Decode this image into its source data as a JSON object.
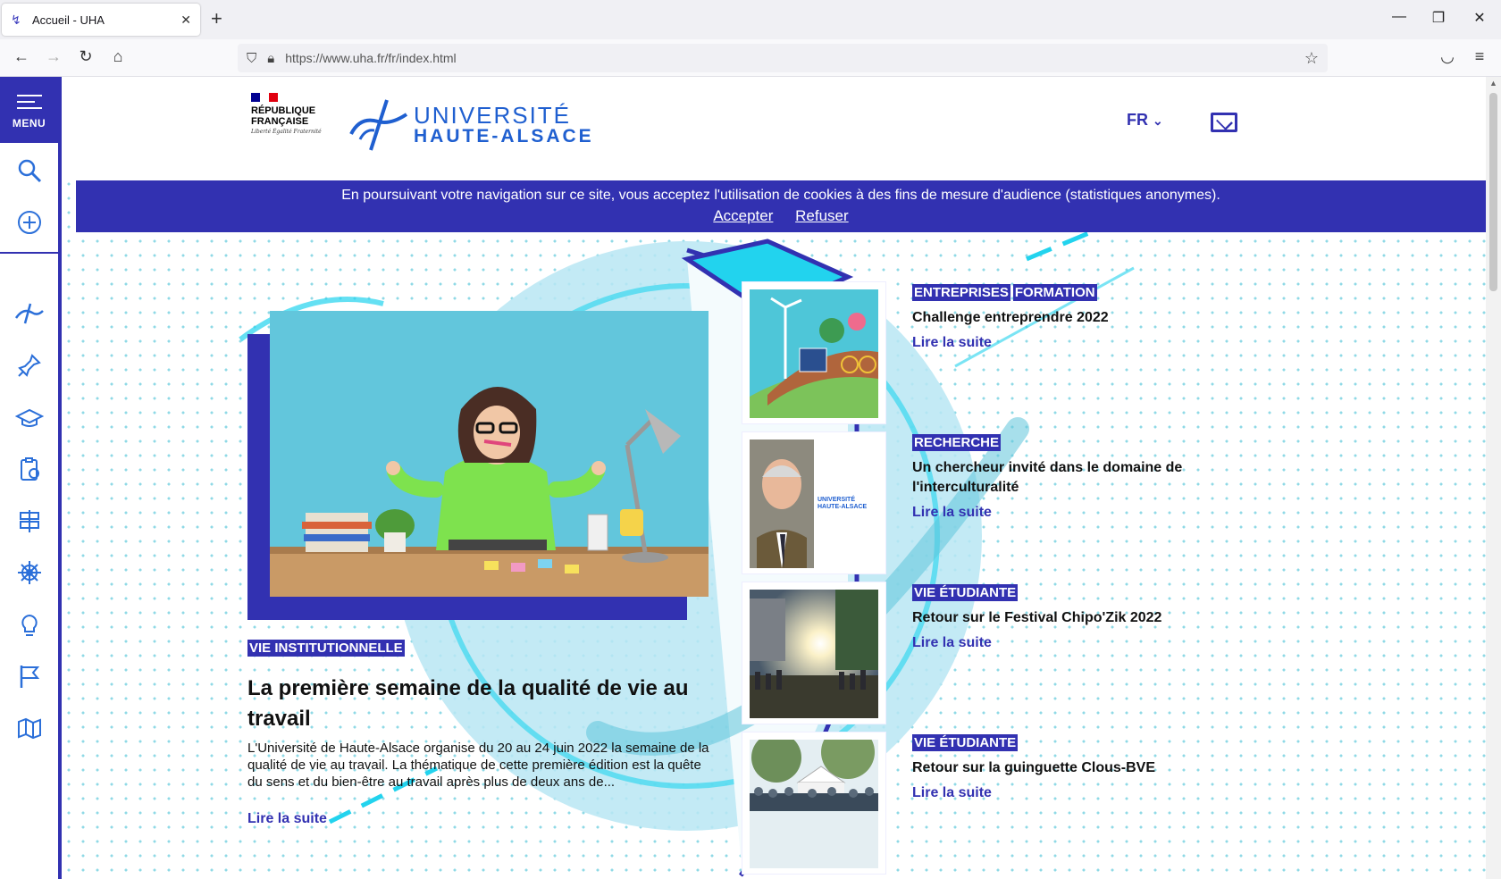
{
  "browser": {
    "tab_title": "Accueil - UHA",
    "url": "https://www.uha.fr/fr/index.html"
  },
  "sidebar": {
    "menu_label": "MENU"
  },
  "header": {
    "rf_text": "RÉPUBLIQUE FRANÇAISE",
    "rf_motto": "Liberté Égalité Fraternité",
    "logo_line1": "UNIVERSITÉ",
    "logo_line2": "HAUTE-ALSACE",
    "language": "FR"
  },
  "cookie": {
    "message": "En poursuivant votre navigation sur ce site, vous acceptez l'utilisation de cookies à des fins de mesure d'audience (statistiques anonymes).",
    "accept": "Accepter",
    "refuse": "Refuser"
  },
  "featured": {
    "tag": "VIE INSTITUTIONNELLE",
    "title": "La première semaine de la qualité de vie au travail",
    "excerpt": "L'Université de Haute-Alsace organise du 20 au 24 juin 2022 la semaine de la qualité de vie au travail. La thématique de cette première édition est la quête du sens et du bien-être au travail après plus de deux ans de...",
    "read_more": "Lire la suite"
  },
  "news": [
    {
      "tags": [
        "ENTREPRISES",
        "FORMATION"
      ],
      "title": "Challenge entreprendre 2022",
      "read_more": "Lire la suite"
    },
    {
      "tags": [
        "RECHERCHE"
      ],
      "title": "Un chercheur invité dans le domaine de l'interculturalité",
      "read_more": "Lire la suite",
      "thumb_logo": "UNIVERSITÉ HAUTE-ALSACE"
    },
    {
      "tags": [
        "VIE ÉTUDIANTE"
      ],
      "title": "Retour sur le Festival Chipo'Zik 2022",
      "read_more": "Lire la suite"
    },
    {
      "tags": [
        "VIE ÉTUDIANTE"
      ],
      "title": "Retour sur la guinguette Clous-BVE",
      "read_more": "Lire la suite"
    }
  ],
  "colors": {
    "brand": "#3231b1",
    "accent_cyan": "#22d3ee",
    "logo_blue": "#1f5fd0"
  }
}
